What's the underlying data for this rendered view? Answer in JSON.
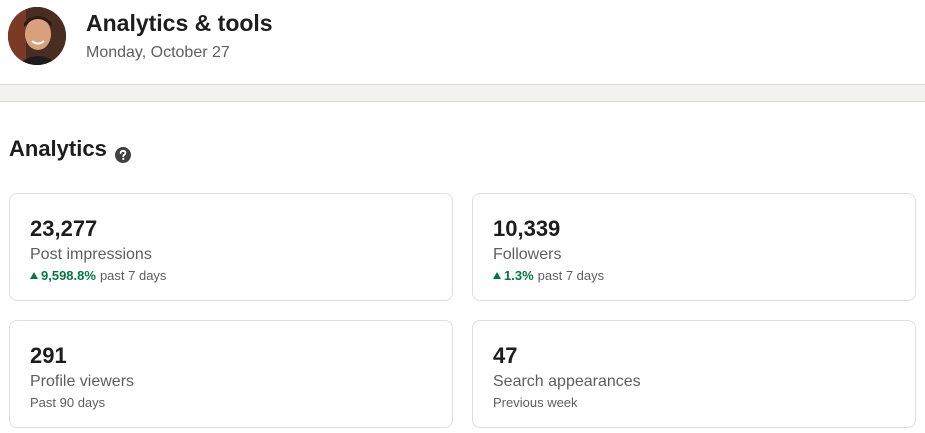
{
  "header": {
    "title": "Analytics & tools",
    "date": "Monday, October 27"
  },
  "analytics": {
    "title": "Analytics",
    "help_icon": "question-circle-icon",
    "cards": [
      {
        "value": "23,277",
        "label": "Post impressions",
        "trend": "9,598.8%",
        "trend_direction": "up",
        "period": "past 7 days"
      },
      {
        "value": "10,339",
        "label": "Followers",
        "trend": "1.3%",
        "trend_direction": "up",
        "period": "past 7 days"
      },
      {
        "value": "291",
        "label": "Profile viewers",
        "period": "Past 90 days"
      },
      {
        "value": "47",
        "label": "Search appearances",
        "period": "Previous week"
      }
    ]
  },
  "colors": {
    "positive_trend": "#057642",
    "text_primary": "#1d1d1d",
    "text_secondary": "#5e5e5e",
    "band": "#f3f2ef"
  }
}
